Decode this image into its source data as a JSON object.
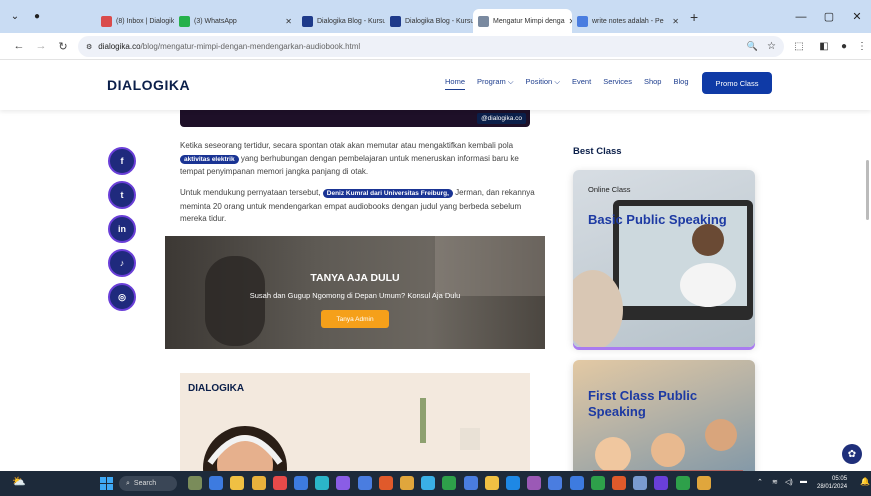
{
  "browser": {
    "tabs": [
      {
        "title": "(8) Inbox | Dialogika",
        "color": "#d94b4b",
        "active": false
      },
      {
        "title": "(3) WhatsApp",
        "color": "#25b14b",
        "active": false
      },
      {
        "title": "Dialogika Blog - Kursus",
        "color": "#1e3a8a",
        "active": false
      },
      {
        "title": "Dialogika Blog - Kursus",
        "color": "#1e3a8a",
        "active": false
      },
      {
        "title": "Mengatur Mimpi denga",
        "color": "#7a8aa0",
        "active": true
      },
      {
        "title": "write notes adalah - Pe",
        "color": "#4a7de0",
        "active": false
      }
    ],
    "url_domain": "dialogika.co",
    "url_path": "/blog/mengatur-mimpi-dengan-mendengarkan-audiobook.html"
  },
  "site": {
    "logo": "DIALOGIKA",
    "nav": [
      "Home",
      "Program ⌵",
      "Position ⌵",
      "Event",
      "Services",
      "Shop",
      "Blog"
    ],
    "promo_label": "Promo Class",
    "handle": "@dialogika.co",
    "para1_a": "Ketika seseorang tertidur, secara spontan otak akan memutar atau mengaktifkan kembali pola",
    "para1_tag": "aktivitas elektrik",
    "para1_b": "yang berhubungan dengan pembelajaran untuk meneruskan informasi baru ke tempat penyimpanan memori jangka panjang di otak.",
    "para2_a": "Untuk mendukung pernyataan tersebut,",
    "para2_tag": "Deniz Kumral dari Universitas Freiburg,",
    "para2_b": "Jerman, dan rekannya meminta 20 orang untuk mendengarkan empat audiobooks dengan judul yang berbeda sebelum mereka tidur.",
    "banner_title": "TANYA AJA DULU",
    "banner_sub": "Susah dan Gugup Ngomong di Depan Umum? Konsul Aja Dulu",
    "banner_btn": "Tanya Admin",
    "card2_logo": "DIALOGIKA",
    "best_class": "Best Class",
    "class1_label": "Online Class",
    "class1_title": "Basic Public Speaking",
    "class2_title": "First Class Public Speaking",
    "social": [
      "f",
      "t",
      "in",
      "♪",
      "◎"
    ]
  },
  "taskbar": {
    "search": "Search",
    "time": "05:05",
    "date": "28/01/2024"
  }
}
